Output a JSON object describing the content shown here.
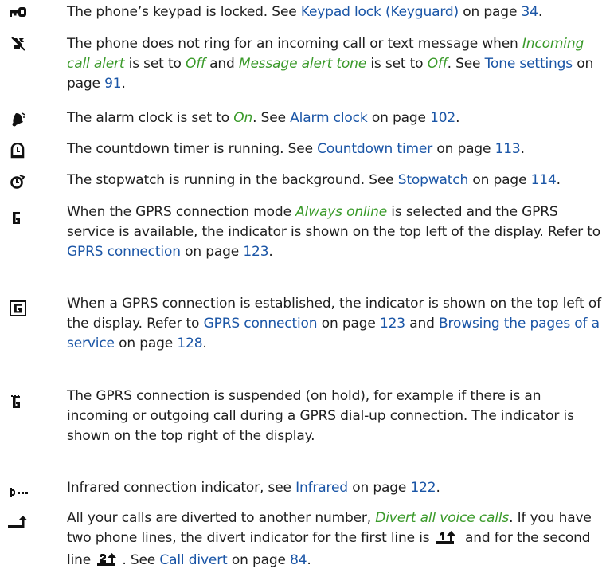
{
  "entries": [
    {
      "icon": "keypad-lock-icon",
      "parts": [
        {
          "t": "The phone’s keypad is locked. See "
        },
        {
          "t": "Keypad lock (Keyguard)",
          "k": "link"
        },
        {
          "t": " on page "
        },
        {
          "t": "34",
          "k": "link"
        },
        {
          "t": "."
        }
      ]
    },
    {
      "icon": "silent-icon",
      "parts": [
        {
          "t": "The phone does not ring for an incoming call or text message when "
        },
        {
          "t": "Incoming call alert",
          "k": "em"
        },
        {
          "t": " is set to "
        },
        {
          "t": "Off",
          "k": "em"
        },
        {
          "t": " and "
        },
        {
          "t": "Message alert tone",
          "k": "em"
        },
        {
          "t": " is set to "
        },
        {
          "t": "Off",
          "k": "em"
        },
        {
          "t": ". See "
        },
        {
          "t": "Tone settings",
          "k": "link"
        },
        {
          "t": " on page "
        },
        {
          "t": "91",
          "k": "link"
        },
        {
          "t": "."
        }
      ]
    },
    {
      "icon": "alarm-bell-icon",
      "parts": [
        {
          "t": "The alarm clock is set to "
        },
        {
          "t": "On",
          "k": "em"
        },
        {
          "t": ". See "
        },
        {
          "t": "Alarm clock",
          "k": "link"
        },
        {
          "t": " on page "
        },
        {
          "t": "102",
          "k": "link"
        },
        {
          "t": "."
        }
      ]
    },
    {
      "icon": "countdown-timer-icon",
      "parts": [
        {
          "t": "The countdown timer is running. See "
        },
        {
          "t": "Countdown timer",
          "k": "link"
        },
        {
          "t": " on page "
        },
        {
          "t": "113",
          "k": "link"
        },
        {
          "t": "."
        }
      ]
    },
    {
      "icon": "stopwatch-icon",
      "parts": [
        {
          "t": "The stopwatch is running in the background. See "
        },
        {
          "t": "Stopwatch",
          "k": "link"
        },
        {
          "t": " on page "
        },
        {
          "t": "114",
          "k": "link"
        },
        {
          "t": "."
        }
      ]
    },
    {
      "icon": "gprs-always-online-icon",
      "parts": [
        {
          "t": "When the GPRS connection mode "
        },
        {
          "t": "Always online",
          "k": "em"
        },
        {
          "t": " is selected and the GPRS service is available, the indicator is shown on the top left of the display. Refer to "
        },
        {
          "t": "GPRS connection",
          "k": "link"
        },
        {
          "t": " on page "
        },
        {
          "t": "123",
          "k": "link"
        },
        {
          "t": "."
        }
      ]
    },
    {
      "icon": "gprs-connected-icon",
      "parts": [
        {
          "t": "When a GPRS connection is established, the indicator is shown on the top left of the display. Refer to "
        },
        {
          "t": "GPRS connection",
          "k": "link"
        },
        {
          "t": " on page "
        },
        {
          "t": "123",
          "k": "link"
        },
        {
          "t": " and "
        },
        {
          "t": "Browsing the pages of a service",
          "k": "link"
        },
        {
          "t": " on page "
        },
        {
          "t": "128",
          "k": "link"
        },
        {
          "t": "."
        }
      ]
    },
    {
      "icon": "gprs-suspended-icon",
      "parts": [
        {
          "t": "The GPRS connection is suspended (on hold), for example if there is an incoming or outgoing call during a GPRS dial-up connection. The indicator is shown on the top right of the display."
        }
      ]
    },
    {
      "icon": "infrared-icon",
      "parts": [
        {
          "t": "Infrared connection indicator, see "
        },
        {
          "t": "Infrared",
          "k": "link"
        },
        {
          "t": " on page "
        },
        {
          "t": "122",
          "k": "link"
        },
        {
          "t": "."
        }
      ]
    },
    {
      "icon": "call-divert-icon",
      "parts": [
        {
          "t": "All your calls are diverted to another number, "
        },
        {
          "t": "Divert all voice calls",
          "k": "em"
        },
        {
          "t": ". If you have two phone lines, the divert indicator for the first line is "
        },
        {
          "icon": "divert-line-1-icon"
        },
        {
          "t": " and for the second line "
        },
        {
          "icon": "divert-line-2-icon"
        },
        {
          "t": ". See "
        },
        {
          "t": "Call divert",
          "k": "link"
        },
        {
          "t": " on page "
        },
        {
          "t": "84",
          "k": "link"
        },
        {
          "t": "."
        }
      ]
    }
  ]
}
